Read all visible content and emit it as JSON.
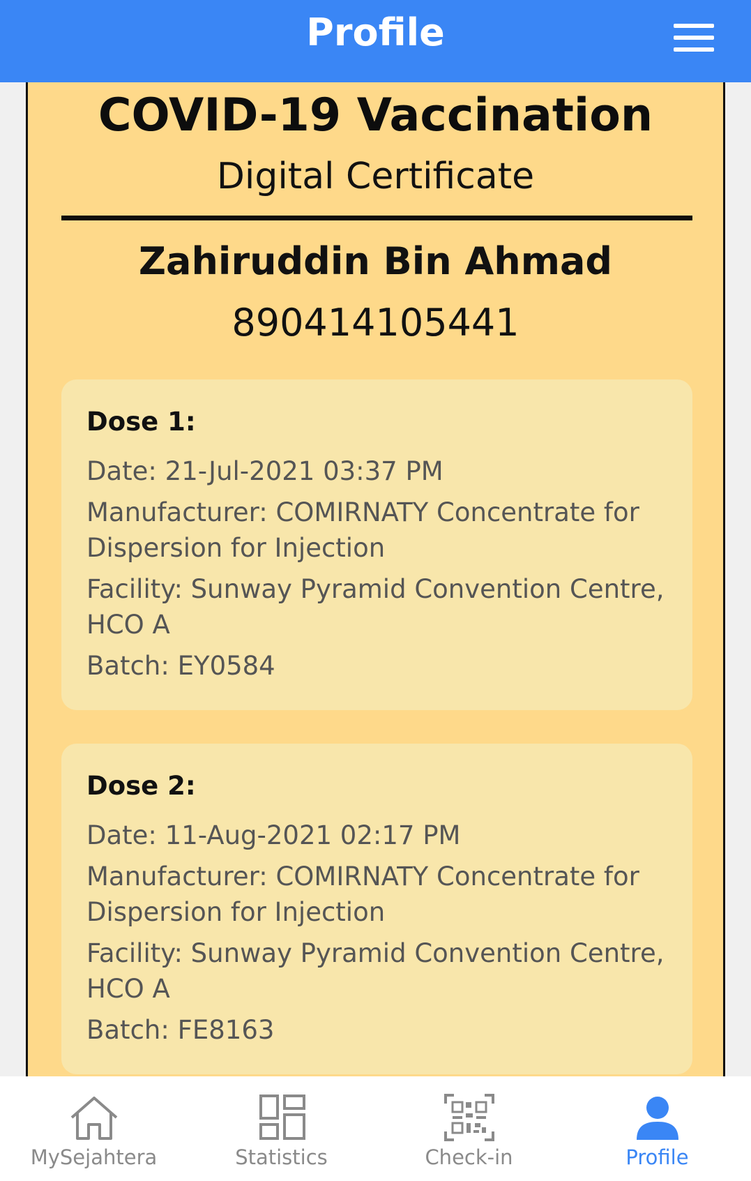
{
  "header": {
    "title": "Profile",
    "menu_icon": "hamburger-menu-icon"
  },
  "certificate": {
    "title": "COVID-19 Vaccination",
    "subtitle": "Digital Certificate",
    "holder_name": "Zahiruddin Bin Ahmad",
    "holder_id": "890414105441",
    "background_color": "#fed98a",
    "card_color": "#f8e6ab",
    "doses": [
      {
        "heading": "Dose 1:",
        "date": "Date: 21-Jul-2021 03:37 PM",
        "manufacturer": "Manufacturer: COMIRNATY Concentrate for Dispersion for Injection",
        "facility": "Facility: Sunway Pyramid Convention Centre, HCO A",
        "batch": "Batch: EY0584"
      },
      {
        "heading": "Dose 2:",
        "date": "Date: 11-Aug-2021 02:17 PM",
        "manufacturer": "Manufacturer: COMIRNATY Concentrate for Dispersion for Injection",
        "facility": "Facility: Sunway Pyramid Convention Centre, HCO A",
        "batch": "Batch: FE8163"
      }
    ]
  },
  "tabbar": {
    "active_color": "#3a86f5",
    "inactive_color": "#8a8a8a",
    "tabs": [
      {
        "label": "MySejahtera",
        "icon": "home-icon",
        "active": false
      },
      {
        "label": "Statistics",
        "icon": "grid-icon",
        "active": false
      },
      {
        "label": "Check-in",
        "icon": "qr-code-icon",
        "active": false
      },
      {
        "label": "Profile",
        "icon": "person-icon",
        "active": true
      }
    ]
  },
  "theme": {
    "header_color": "#3a86f5"
  }
}
